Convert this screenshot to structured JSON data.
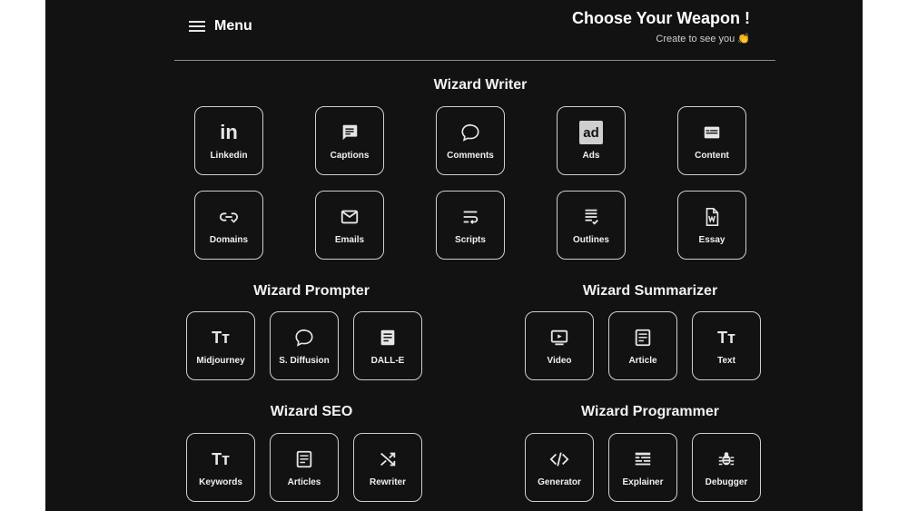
{
  "header": {
    "menu_label": "Menu",
    "title": "Choose Your Weapon !",
    "subtitle": "Create to see you 👏"
  },
  "sections": {
    "writer": {
      "title": "Wizard Writer",
      "tiles": [
        {
          "label": "Linkedin",
          "icon": "linkedin-icon"
        },
        {
          "label": "Captions",
          "icon": "caption-icon"
        },
        {
          "label": "Comments",
          "icon": "comment-icon"
        },
        {
          "label": "Ads",
          "icon": "ad-icon"
        },
        {
          "label": "Content",
          "icon": "content-icon"
        },
        {
          "label": "Domains",
          "icon": "link-icon"
        },
        {
          "label": "Emails",
          "icon": "email-icon"
        },
        {
          "label": "Scripts",
          "icon": "wrap-text-icon"
        },
        {
          "label": "Outlines",
          "icon": "outline-icon"
        },
        {
          "label": "Essay",
          "icon": "word-document-icon"
        }
      ]
    },
    "prompter": {
      "title": "Wizard Prompter",
      "tiles": [
        {
          "label": "Midjourney",
          "icon": "text-size-icon"
        },
        {
          "label": "S. Diffusion",
          "icon": "comment-icon"
        },
        {
          "label": "DALL-E",
          "icon": "article-icon"
        }
      ]
    },
    "summarizer": {
      "title": "Wizard Summarizer",
      "tiles": [
        {
          "label": "Video",
          "icon": "video-icon"
        },
        {
          "label": "Article",
          "icon": "article-icon"
        },
        {
          "label": "Text",
          "icon": "text-size-icon"
        }
      ]
    },
    "seo": {
      "title": "Wizard SEO",
      "tiles": [
        {
          "label": "Keywords",
          "icon": "text-size-icon"
        },
        {
          "label": "Articles",
          "icon": "article-icon"
        },
        {
          "label": "Rewriter",
          "icon": "shuffle-icon"
        }
      ]
    },
    "programmer": {
      "title": "Wizard Programmer",
      "tiles": [
        {
          "label": "Generator",
          "icon": "code-icon"
        },
        {
          "label": "Explainer",
          "icon": "explainer-icon"
        },
        {
          "label": "Debugger",
          "icon": "bug-icon"
        }
      ]
    }
  },
  "icons": {
    "linkedin_text": "in",
    "ad_text": "ad",
    "text_size_text": "Tт"
  },
  "colors": {
    "background": "#121212",
    "tile_border": "#cfcfcf",
    "text": "#ffffff"
  }
}
